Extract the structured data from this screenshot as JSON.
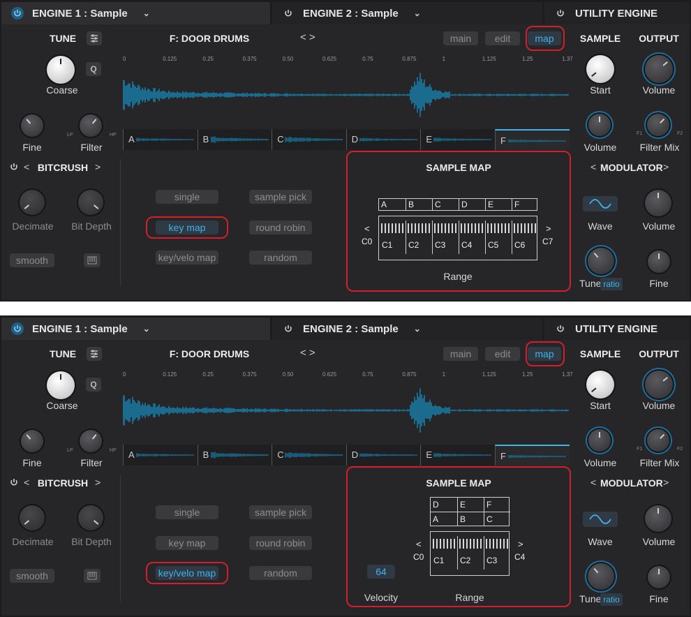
{
  "header": {
    "engine1": "ENGINE 1 : Sample",
    "engine2": "ENGINE 2 : Sample",
    "utility": "UTILITY ENGINE"
  },
  "tune": {
    "title": "TUNE",
    "coarse": "Coarse",
    "fine": "Fine",
    "filter": "Filter",
    "lp": "LP",
    "hp": "HP",
    "q": "Q"
  },
  "sample": {
    "name": "F:  DOOR DRUMS",
    "nav": "< >",
    "tabs": [
      "main",
      "edit",
      "map"
    ]
  },
  "ruler": [
    "0",
    "0.125",
    "0.25",
    "0.375",
    "0.50",
    "0.625",
    "0.75",
    "0.875",
    "1",
    "1.125",
    "1.25",
    "1.37"
  ],
  "slots": [
    "A",
    "B",
    "C",
    "D",
    "E",
    "F"
  ],
  "bitcrush": {
    "title": "BITCRUSH",
    "decimate": "Decimate",
    "bitdepth": "Bit Depth",
    "smooth": "smooth"
  },
  "modes": [
    "single",
    "key map",
    "key/velo map",
    "sample pick",
    "round robin",
    "random"
  ],
  "map1": {
    "title": "SAMPLE MAP",
    "zones": [
      "A",
      "B",
      "C",
      "D",
      "E",
      "F"
    ],
    "octaves": [
      "C1",
      "C2",
      "C3",
      "C4",
      "C5",
      "C6"
    ],
    "low": "C0",
    "high": "C7",
    "range": "Range"
  },
  "map2": {
    "title": "SAMPLE MAP",
    "top": [
      "D",
      "E",
      "F"
    ],
    "bottom": [
      "A",
      "B",
      "C"
    ],
    "octaves": [
      "C1",
      "C2",
      "C3"
    ],
    "low": "C0",
    "high": "C4",
    "range": "Range",
    "velocity_label": "Velocity",
    "velocity": "64"
  },
  "utility_section": {
    "sample": "SAMPLE",
    "output": "OUTPUT",
    "start": "Start",
    "volume": "Volume",
    "volume2": "Volume",
    "filtermix": "Filter Mix",
    "f1": "F1",
    "f2": "F2"
  },
  "modulator": {
    "title": "MODULATOR",
    "wave": "Wave",
    "volume": "Volume",
    "tune": "Tune",
    "ratio": "ratio",
    "fine": "Fine"
  },
  "colors": {
    "accent": "#3fb3ea",
    "highlight": "#d21f2c",
    "wave": "#1a6b8d"
  }
}
